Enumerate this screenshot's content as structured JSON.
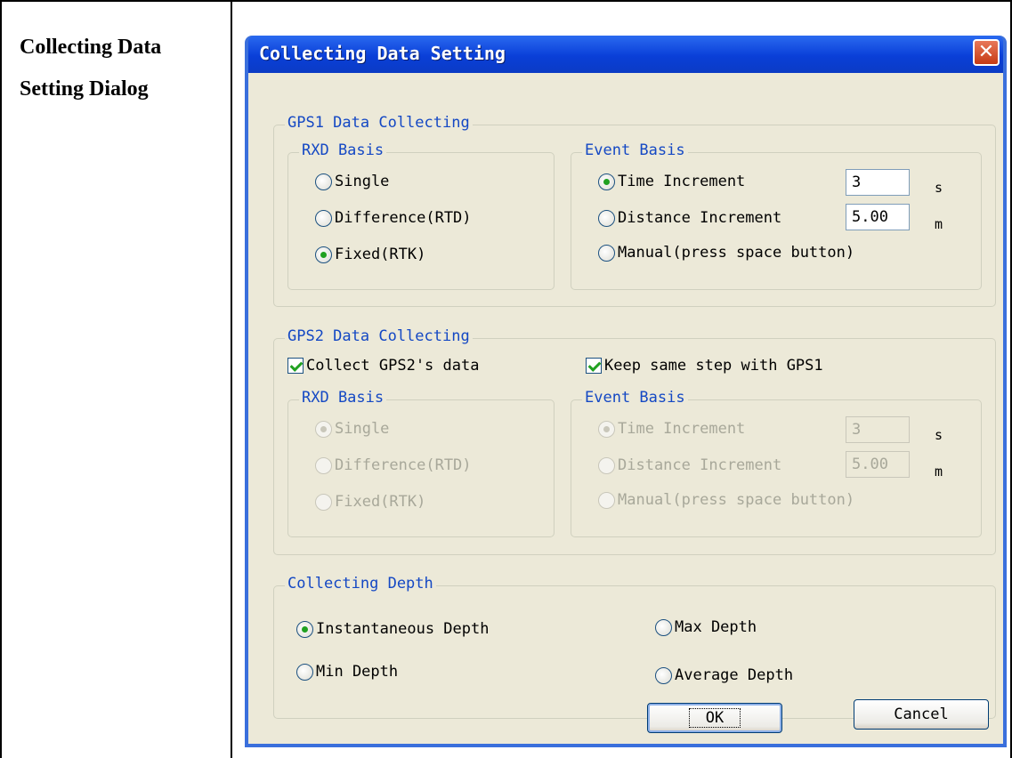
{
  "doc": {
    "label": "Collecting Data Setting Dialog"
  },
  "dialog": {
    "title": "Collecting Data Setting",
    "close_label": "✕",
    "gps1": {
      "legend": "GPS1 Data Collecting",
      "rxd": {
        "legend": "RXD Basis",
        "options": [
          "Single",
          "Difference(RTD)",
          "Fixed(RTK)"
        ],
        "selected": "Fixed(RTK)"
      },
      "event": {
        "legend": "Event Basis",
        "time_label": "Time Increment",
        "time_value": "3",
        "time_unit": "s",
        "distance_label": "Distance Increment",
        "distance_value": "5.00",
        "distance_unit": "m",
        "manual_label": "Manual(press space button)",
        "selected": "Time Increment"
      }
    },
    "gps2": {
      "legend": "GPS2 Data Collecting",
      "collect_label": "Collect GPS2's data",
      "collect_checked": true,
      "same_step_label": "Keep same step with GPS1",
      "same_step_checked": true,
      "rxd": {
        "legend": "RXD Basis",
        "options": [
          "Single",
          "Difference(RTD)",
          "Fixed(RTK)"
        ],
        "selected": "Single"
      },
      "event": {
        "legend": "Event Basis",
        "time_label": "Time Increment",
        "time_value": "3",
        "time_unit": "s",
        "distance_label": "Distance Increment",
        "distance_value": "5.00",
        "distance_unit": "m",
        "manual_label": "Manual(press space button)",
        "selected": "Time Increment"
      }
    },
    "depth": {
      "legend": "Collecting Depth",
      "instantaneous": "Instantaneous Depth",
      "max": "Max Depth",
      "min": "Min Depth",
      "average": "Average Depth",
      "selected": "Instantaneous Depth"
    },
    "ok_label": "OK",
    "cancel_label": "Cancel"
  },
  "colors": {
    "title_bar": "#0a3fd8",
    "client_bg": "#ece9d8",
    "legend_text": "#1448c4",
    "check_mark": "#21a121",
    "close_button": "#c63a14"
  }
}
